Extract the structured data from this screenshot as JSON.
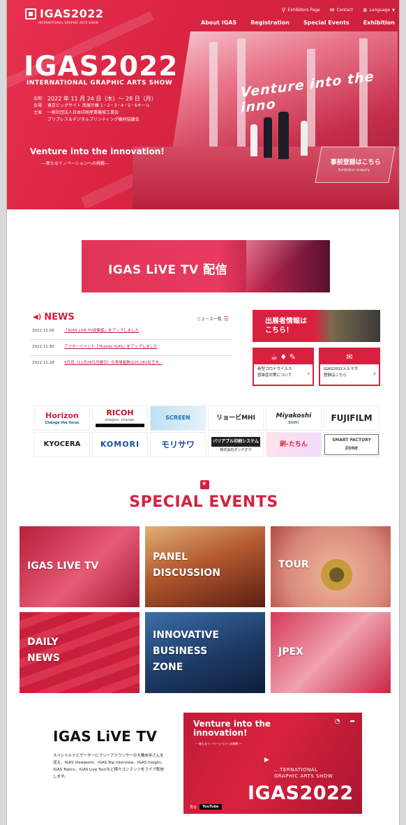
{
  "header": {
    "logo": "IGAS2022",
    "logo_sub": "INTERNATIONAL GRAPHIC ARTS SHOW",
    "utility": [
      "Exhibitors Page",
      "Contact",
      "Language"
    ],
    "nav": [
      "About IGAS",
      "Registration",
      "Special Events",
      "Exhibition"
    ]
  },
  "hero": {
    "title": "IGAS2022",
    "subtitle": "INTERNATIONAL GRAPHIC ARTS SHOW",
    "info": [
      {
        "k": "会期",
        "v": "2022 年 11 月 24 日（木）〜 28 日（月）"
      },
      {
        "k": "会場",
        "v": "東京ビッグサイト 南展示棟 1・2・3・4・5・6ホール"
      },
      {
        "k": "主催",
        "v": "一般社団法人日本印刷産業機械工業会"
      },
      {
        "k": "",
        "v": "プリプレス＆デジタルプリンティング機材協議会"
      }
    ],
    "booth_text": "Venture into the inno",
    "tagline": "Venture into the innovation!",
    "tagline_sub": "―新たなイノベーションへの挑戦―",
    "pre_reg": "事前登録はこちら",
    "pre_reg_sub": "Exhibition enquiry"
  },
  "live_banner": "IGAS LiVE TV 配信",
  "news": {
    "title": "NEWS",
    "all_label": "ニュース一覧",
    "items": [
      {
        "date": "2022.12.09",
        "text": "「IGAS LIVE TV総集編」をアップしました"
      },
      {
        "date": "2022.11.30",
        "text": "アフターイベント「Thanks IGAS」をアップしました"
      },
      {
        "date": "2022.11.28",
        "text": "5日目（11月28日月曜日）の来場者数は25,282名です。"
      }
    ]
  },
  "exhibitor_card": "出展者情報は\nこちら！",
  "mini_cards": [
    {
      "label": "新型コロナウイルス\n感染症対策について"
    },
    {
      "label": "IGAS2022メルマガ\n登録はこちら"
    }
  ],
  "sponsors": [
    {
      "name": "Horizon",
      "sub": "Change the focus",
      "color": "#d6203f"
    },
    {
      "name": "RICOH",
      "sub": "imagine. change.",
      "color": "#c8102e"
    },
    {
      "name": "SCREEN",
      "sub": "",
      "color": "#1a6fb5"
    },
    {
      "name": "リョービMHI",
      "sub": "",
      "color": "#111111"
    },
    {
      "name": "Miyakoshi",
      "sub": "Shift!",
      "color": "#1a1a1a"
    },
    {
      "name": "FUJIFILM",
      "sub": "",
      "color": "#111111"
    },
    {
      "name": "KYOCERA",
      "sub": "",
      "color": "#111111"
    },
    {
      "name": "KOMORI",
      "sub": "",
      "color": "#1b4ea0"
    },
    {
      "name": "モリサワ",
      "sub": "",
      "color": "#1b4ea0"
    },
    {
      "name": "バリアブル印刷システム",
      "sub": "株式会社オンデオマ",
      "color": "#111111"
    },
    {
      "name": "刷-たちん",
      "sub": "",
      "color": "#d6203f"
    },
    {
      "name": "SMART FACTORY ZONE",
      "sub": "",
      "color": "#444444"
    }
  ],
  "special_events": {
    "title": "SPECIAL EVENTS",
    "tiles": [
      {
        "label": "IGAS LIVE TV"
      },
      {
        "label": "PANEL\nDISCUSSION"
      },
      {
        "label": "TOUR"
      },
      {
        "label": "DAILY\nNEWS"
      },
      {
        "label": "INNOVATIVE\nBUSINESS\nZONE"
      },
      {
        "label": "JPEX"
      }
    ]
  },
  "live_tv": {
    "title": "IGAS LiVE TV",
    "desc": "スペシャルナビゲーターにフリーアナウンサーの大橋未歩さんを迎え、IGAS Viewpoint、IGAS Top Interview、IGAS Insight、IGAS Topics、IGAS Live Tourなど様々コンテンツをライブ配信します。",
    "video": {
      "headline": "Venture into the\ninnovation!",
      "headline_sub": "― 新たなイノベーションへの挑戦 ―",
      "show": "...TERNATIONAL\nGRAPHIC ARTS SHOW",
      "big": "IGAS2022",
      "yt": "YouTube",
      "yt_pre": "見る"
    }
  },
  "colors": {
    "brand": "#d6203f"
  }
}
